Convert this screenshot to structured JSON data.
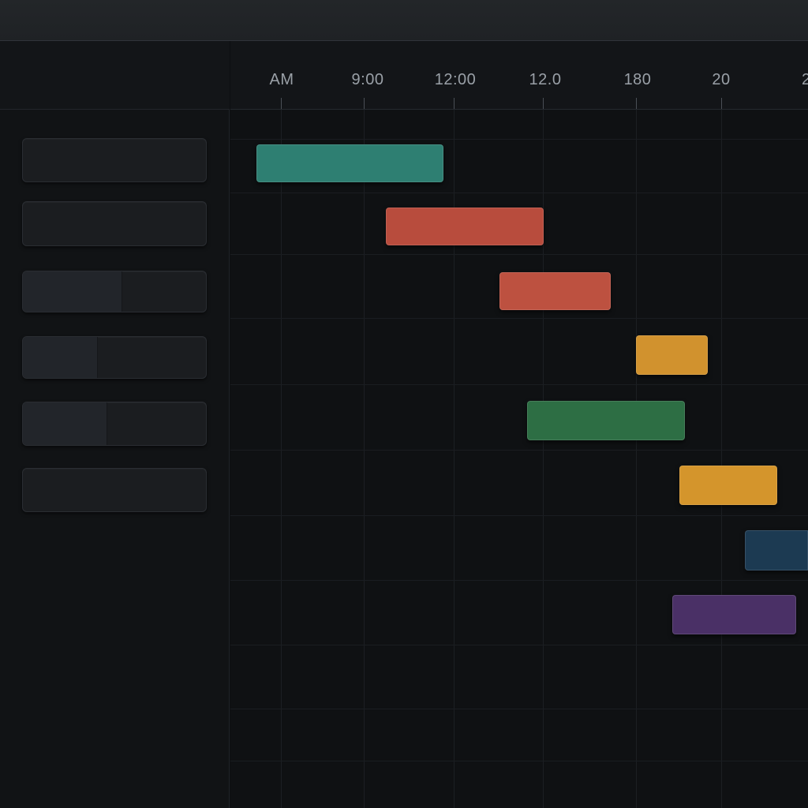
{
  "timeline": {
    "ticks": [
      {
        "label": "AM"
      },
      {
        "label": "9:00"
      },
      {
        "label": "12:00"
      },
      {
        "label": "12.0"
      },
      {
        "label": "180"
      },
      {
        "label": "20"
      },
      {
        "label": "2"
      }
    ],
    "bars": [
      {
        "row": 1,
        "color": "#2e7f72"
      },
      {
        "row": 2,
        "color": "#b84c3d"
      },
      {
        "row": 3,
        "color": "#bd5140"
      },
      {
        "row": 4,
        "color": "#d1922e"
      },
      {
        "row": 5,
        "color": "#2d6e44"
      },
      {
        "row": 6,
        "color": "#d4952c"
      },
      {
        "row": 7,
        "color": "#1c3a52"
      },
      {
        "row": 8,
        "color": "#4a3066"
      }
    ]
  },
  "sidebar": {
    "rows": [
      {
        "id": "row-1"
      },
      {
        "id": "row-2"
      },
      {
        "id": "row-3"
      },
      {
        "id": "row-4"
      },
      {
        "id": "row-5"
      },
      {
        "id": "row-6"
      }
    ]
  },
  "theme": {
    "background": "#0d0f11",
    "toolbar": "#232629",
    "tick_text": "#9aa0a7"
  }
}
